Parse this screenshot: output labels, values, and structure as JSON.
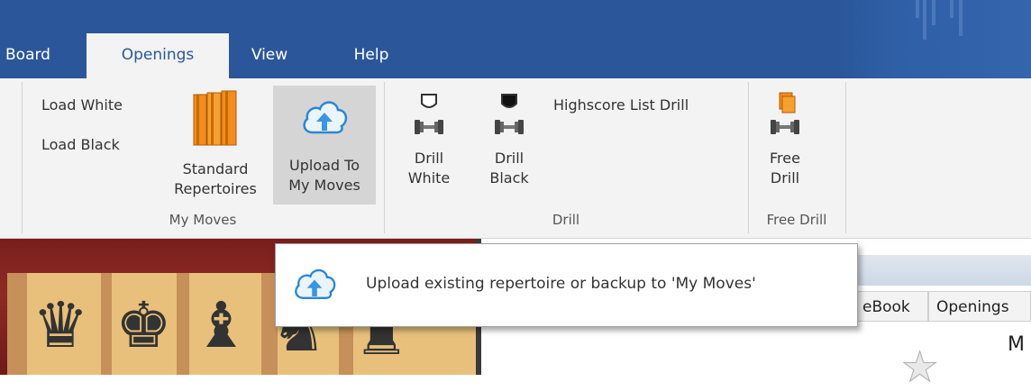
{
  "tabs": [
    {
      "label": "Board",
      "active": false
    },
    {
      "label": "Openings",
      "active": true
    },
    {
      "label": "View",
      "active": false
    },
    {
      "label": "Help",
      "active": false
    }
  ],
  "ribbon": {
    "my_moves": {
      "group_label": "My Moves",
      "load_white": "Load White",
      "load_black": "Load Black",
      "standard_line1": "Standard",
      "standard_line2": "Repertoires",
      "upload_line1": "Upload To",
      "upload_line2": "My Moves"
    },
    "drill": {
      "group_label": "Drill",
      "drill_white_line1": "Drill",
      "drill_white_line2": "White",
      "drill_black_line1": "Drill",
      "drill_black_line2": "Black",
      "highscore": "Highscore List Drill"
    },
    "free_drill": {
      "group_label": "Free Drill",
      "line1": "Free",
      "line2": "Drill"
    }
  },
  "tooltip": {
    "text": "Upload existing repertoire or backup to 'My Moves'",
    "icon": "cloud-upload-icon"
  },
  "right_pane": {
    "tabs": [
      "eBook",
      "Openings"
    ],
    "corner_text": "M"
  },
  "colors": {
    "accent": "#2b579a",
    "ribbon_bg": "#f3f3f3",
    "hover_bg": "#d5d5d5"
  }
}
